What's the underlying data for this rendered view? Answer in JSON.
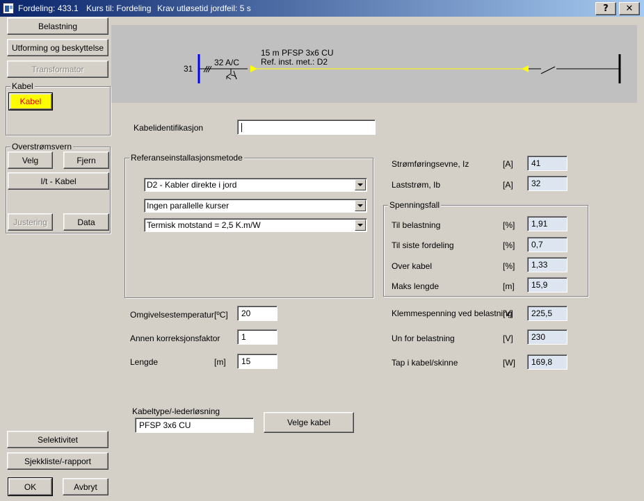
{
  "window": {
    "title_parts": [
      "Fordeling: 433.1",
      "Kurs til: Fordeling",
      "Krav utløsetid jordfeil: 5 s"
    ],
    "help_label": "?",
    "close_label": "✕"
  },
  "sidebar": {
    "belastning": "Belastning",
    "utforming": "Utforming og beskyttelse",
    "transformator": "Transformator",
    "kabel_group": "Kabel",
    "kabel_button": "Kabel",
    "kabel_color": "#ffff00",
    "overstrom_group": "Overstrømsvern",
    "velg": "Velg",
    "fjern": "Fjern",
    "it_kabel": "I/t - Kabel",
    "justering": "Justering",
    "data": "Data",
    "selektivitet": "Selektivitet",
    "sjekkliste": "Sjekkliste/-rapport",
    "ok": "OK",
    "avbryt": "Avbryt"
  },
  "diagram": {
    "node_label": "31",
    "breaker_label": "32 A/C",
    "cable_label": "15 m  PFSP 3x6 CU",
    "ref_label": "Ref. inst. met.: D2",
    "bus_color": "#0000ff",
    "cable_color": "#ffff00"
  },
  "form": {
    "kabelid_label": "Kabelidentifikasjon",
    "kabelid_value": "",
    "ref_group": "Referanseinstallasjonsmetode",
    "select1": "D2 - Kabler direkte i jord",
    "select2": "Ingen parallelle kurser",
    "select3": "Termisk motstand = 2,5 K.m/W",
    "temp_label": "Omgivelsestemperatur",
    "temp_unit": "[ºC]",
    "temp_value": "20",
    "korr_label": "Annen korreksjonsfaktor",
    "korr_value": "1",
    "lengde_label": "Lengde",
    "lengde_unit": "[m]",
    "lengde_value": "15",
    "kabeltype_label": "Kabeltype/-lederløsning",
    "kabeltype_value": "PFSP 3x6 CU",
    "velge_kabel": "Velge kabel"
  },
  "results": {
    "iz_label": "Strømføringsevne, Iz",
    "iz_unit": "[A]",
    "iz_value": "41",
    "ib_label": "Laststrøm, Ib",
    "ib_unit": "[A]",
    "ib_value": "32",
    "spenn_group": "Spenningsfall",
    "tilbel_label": "Til belastning",
    "tilbel_unit": "[%]",
    "tilbel_value": "1,91",
    "tilsiste_label": "Til siste fordeling",
    "tilsiste_unit": "[%]",
    "tilsiste_value": "0,7",
    "over_label": "Over kabel",
    "over_unit": "[%]",
    "over_value": "1,33",
    "maks_label": "Maks lengde",
    "maks_unit": "[m]",
    "maks_value": "15,9",
    "klemme_label": "Klemmespenning ved belastning",
    "klemme_unit": "[V]",
    "klemme_value": "225,5",
    "un_label": "Un for belastning",
    "un_unit": "[V]",
    "un_value": "230",
    "tap_label": "Tap i kabel/skinne",
    "tap_unit": "[W]",
    "tap_value": "169,8"
  }
}
